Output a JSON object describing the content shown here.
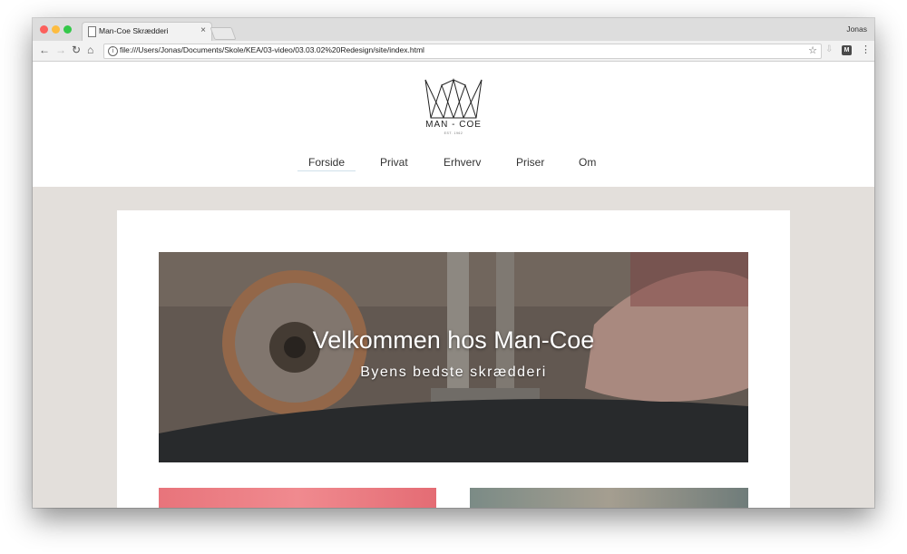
{
  "browser": {
    "tab_title": "Man-Coe Skrædderi",
    "tab_close": "×",
    "profile_name": "Jonas",
    "url": "file:///Users/Jonas/Documents/Skole/KEA/03-video/03.03.02%20Redesign/site/index.html",
    "back_icon": "←",
    "forward_icon": "→",
    "reload_icon": "↻",
    "home_icon": "⌂",
    "info_icon": "i",
    "star_icon": "☆",
    "extension_mark": "M",
    "menu_icon": "⋮"
  },
  "site": {
    "logo_text": "MAN - COE",
    "logo_subtext": "EST. 1962",
    "nav": [
      "Forside",
      "Privat",
      "Erhverv",
      "Priser",
      "Om"
    ],
    "active_nav_index": 0
  },
  "hero": {
    "title": "Velkommen hos Man-Coe",
    "subtitle": "Byens bedste skrædderi"
  },
  "colors": {
    "page_background": "#e3dfdb",
    "accent_underline": "#cfe0ea"
  }
}
